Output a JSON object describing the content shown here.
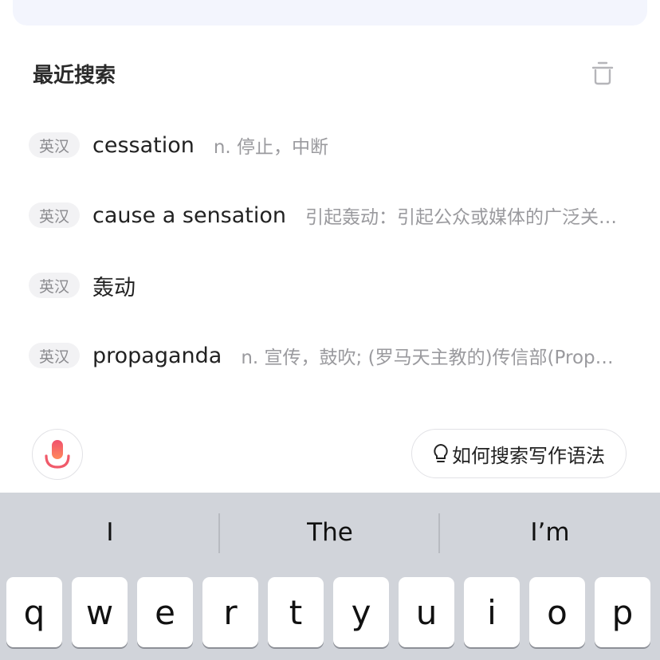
{
  "section": {
    "title": "最近搜索"
  },
  "history": [
    {
      "tag": "英汉",
      "word": "cessation",
      "definition": "n. 停止，中断"
    },
    {
      "tag": "英汉",
      "word": "cause a sensation",
      "definition": "引起轰动：引起公众或媒体的广泛关注和讨论"
    },
    {
      "tag": "英汉",
      "word": "轰动",
      "definition": ""
    },
    {
      "tag": "英汉",
      "word": "propaganda",
      "definition": "n. 宣传，鼓吹; (罗马天主教的)传信部(Propaganda)"
    }
  ],
  "actions": {
    "tip_label": "如何搜索写作语法"
  },
  "keyboard": {
    "suggestions": [
      "I",
      "The",
      "I’m"
    ],
    "keys": [
      "q",
      "w",
      "e",
      "r",
      "t",
      "y",
      "u",
      "i",
      "o",
      "p"
    ]
  },
  "colors": {
    "accent_mic_top": "#f0506e",
    "accent_mic_bottom": "#ff8a5b",
    "search_bg": "#f3f5fd"
  },
  "icons": {
    "trash": "trash-icon",
    "mic": "microphone-icon",
    "bulb": "lightbulb-icon"
  }
}
